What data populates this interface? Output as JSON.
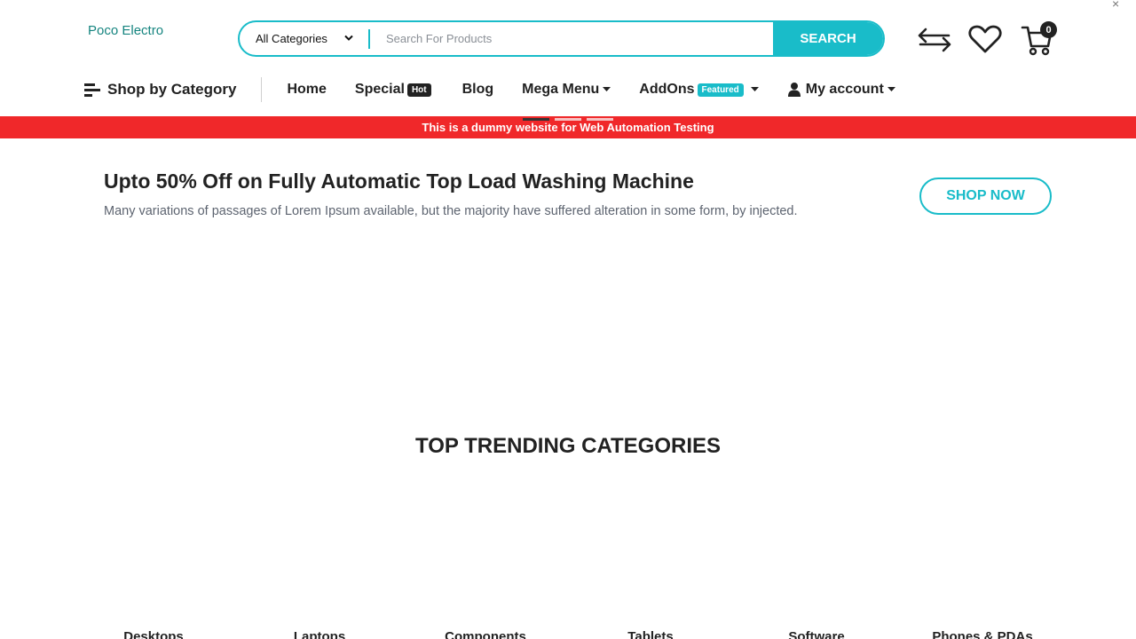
{
  "header": {
    "logo": "Poco Electro",
    "search": {
      "category": "All Categories",
      "placeholder": "Search For Products",
      "button": "SEARCH"
    },
    "cart_count": "0",
    "close": "×"
  },
  "nav": {
    "shop_by_category": "Shop by Category",
    "home": "Home",
    "special": "Special",
    "special_badge": "Hot",
    "blog": "Blog",
    "mega_menu": "Mega Menu",
    "addons": "AddOns",
    "addons_badge": "Featured",
    "my_account": "My account"
  },
  "notice": "This is a dummy website for Web Automation Testing",
  "hero": {
    "title": "Upto 50% Off on Fully Automatic Top Load Washing Machine",
    "subtitle": "Many variations of passages of Lorem Ipsum available, but the majority have suffered alteration in some form, by injected.",
    "cta": "SHOP NOW"
  },
  "trending": {
    "title": "TOP TRENDING CATEGORIES",
    "categories": [
      "Desktops",
      "Laptops",
      "Components",
      "Tablets",
      "Software",
      "Phones & PDAs"
    ]
  },
  "colors": {
    "accent": "#19bcc9",
    "notice_bg": "#f0282a",
    "logo": "#15847f"
  }
}
